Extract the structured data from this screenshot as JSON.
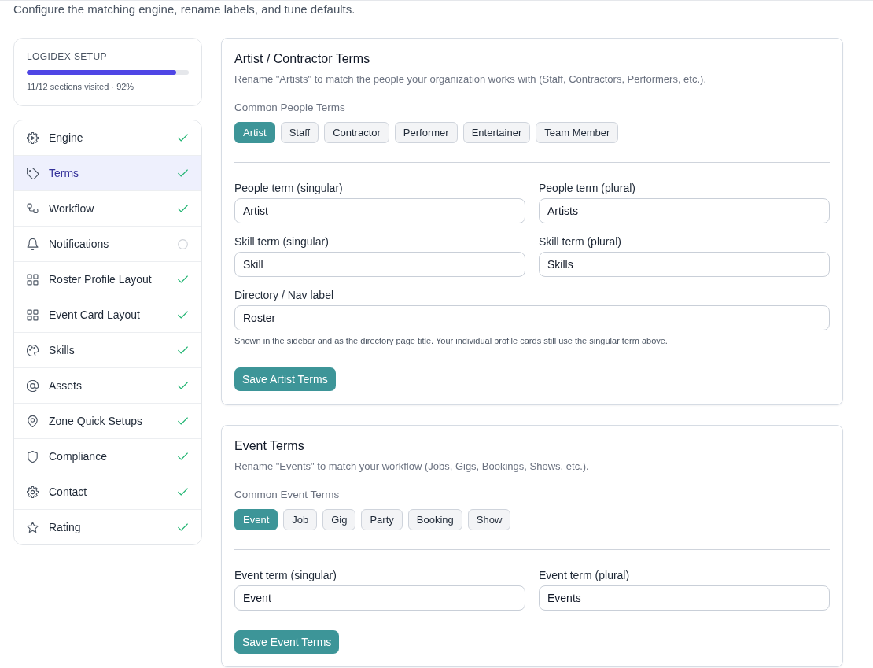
{
  "subtitle": "Configure the matching engine, rename labels, and tune defaults.",
  "progress": {
    "title": "LOGIDEX SETUP",
    "level": 0.92,
    "caption": "11/12 sections visited · 92%"
  },
  "nav": [
    {
      "label": "Engine",
      "selected": false,
      "done": true
    },
    {
      "label": "Terms",
      "selected": true,
      "done": true
    },
    {
      "label": "Workflow",
      "selected": false,
      "done": true
    },
    {
      "label": "Notifications",
      "selected": false,
      "done": false
    },
    {
      "label": "Roster Profile Layout",
      "selected": false,
      "done": true
    },
    {
      "label": "Event Card Layout",
      "selected": false,
      "done": true
    },
    {
      "label": "Skills",
      "selected": false,
      "done": true
    },
    {
      "label": "Assets",
      "selected": false,
      "done": true
    },
    {
      "label": "Zone Quick Setups",
      "selected": false,
      "done": true
    },
    {
      "label": "Compliance",
      "selected": false,
      "done": true
    },
    {
      "label": "Contact",
      "selected": false,
      "done": true
    },
    {
      "label": "Rating",
      "selected": false,
      "done": true
    }
  ],
  "sections": [
    {
      "title": "Artist / Contractor Terms",
      "description": "Rename \"Artists\" to match the people your organization works with (Staff, Contractors, Performers, etc.).",
      "presets_label": "Common People Terms",
      "presets": [
        {
          "label": "Artist",
          "selected": true
        },
        {
          "label": "Staff",
          "selected": false
        },
        {
          "label": "Contractor",
          "selected": false
        },
        {
          "label": "Performer",
          "selected": false
        },
        {
          "label": "Entertainer",
          "selected": false
        },
        {
          "label": "Team Member",
          "selected": false
        }
      ],
      "rows": [
        [
          {
            "label": "People term (singular)",
            "value": "Artist"
          },
          {
            "label": "People term (plural)",
            "value": "Artists"
          }
        ],
        [
          {
            "label": "Skill term (singular)",
            "value": "Skill"
          },
          {
            "label": "Skill term (plural)",
            "value": "Skills"
          }
        ],
        [
          {
            "label": "Directory / Nav label",
            "value": "Roster",
            "hint": "Shown in the sidebar and as the directory page title. Your individual profile cards still use the singular term above."
          }
        ]
      ],
      "button": "Save Artist Terms"
    },
    {
      "title": "Event Terms",
      "description": "Rename \"Events\" to match your workflow (Jobs, Gigs, Bookings, Shows, etc.).",
      "presets_label": "Common Event Terms",
      "presets": [
        {
          "label": "Event",
          "selected": true
        },
        {
          "label": "Job",
          "selected": false
        },
        {
          "label": "Gig",
          "selected": false
        },
        {
          "label": "Party",
          "selected": false
        },
        {
          "label": "Booking",
          "selected": false
        },
        {
          "label": "Show",
          "selected": false
        }
      ],
      "rows": [
        [
          {
            "label": "Event term (singular)",
            "value": "Event"
          },
          {
            "label": "Event term (plural)",
            "value": "Events"
          }
        ]
      ],
      "button": "Save Event Terms"
    }
  ]
}
